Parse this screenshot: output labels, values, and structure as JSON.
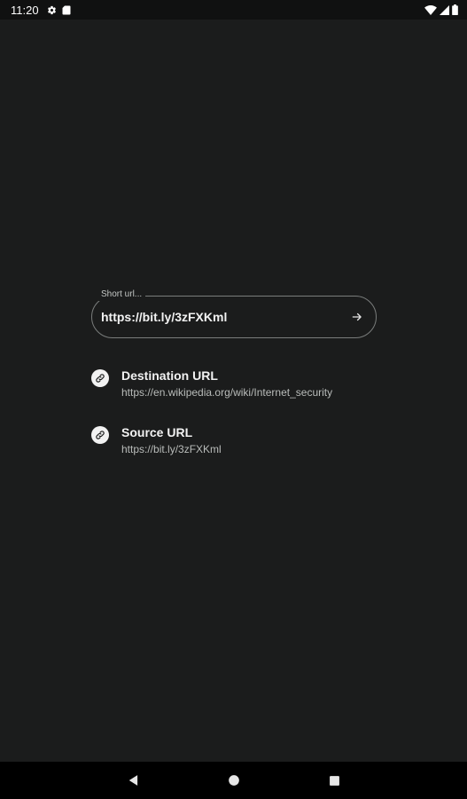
{
  "status_bar": {
    "time": "11:20",
    "icons": [
      "settings-icon",
      "sd-card-icon",
      "wifi-icon",
      "signal-icon",
      "battery-icon"
    ]
  },
  "url_input": {
    "label": "Short url...",
    "value": "https://bit.ly/3zFXKml",
    "submit_icon": "arrow-right-icon"
  },
  "results": [
    {
      "icon": "link-icon",
      "title": "Destination URL",
      "url": "https://en.wikipedia.org/wiki/Internet_security"
    },
    {
      "icon": "link-icon",
      "title": "Source URL",
      "url": "https://bit.ly/3zFXKml"
    }
  ],
  "nav_bar": {
    "buttons": [
      "back-icon",
      "home-icon",
      "recents-icon"
    ]
  },
  "colors": {
    "background": "#1b1c1c",
    "status_bar": "#101111",
    "nav_bar": "#000000",
    "outline": "#7a7d7c",
    "text_primary": "#f2f2f2",
    "text_secondary": "#b9bcba"
  }
}
